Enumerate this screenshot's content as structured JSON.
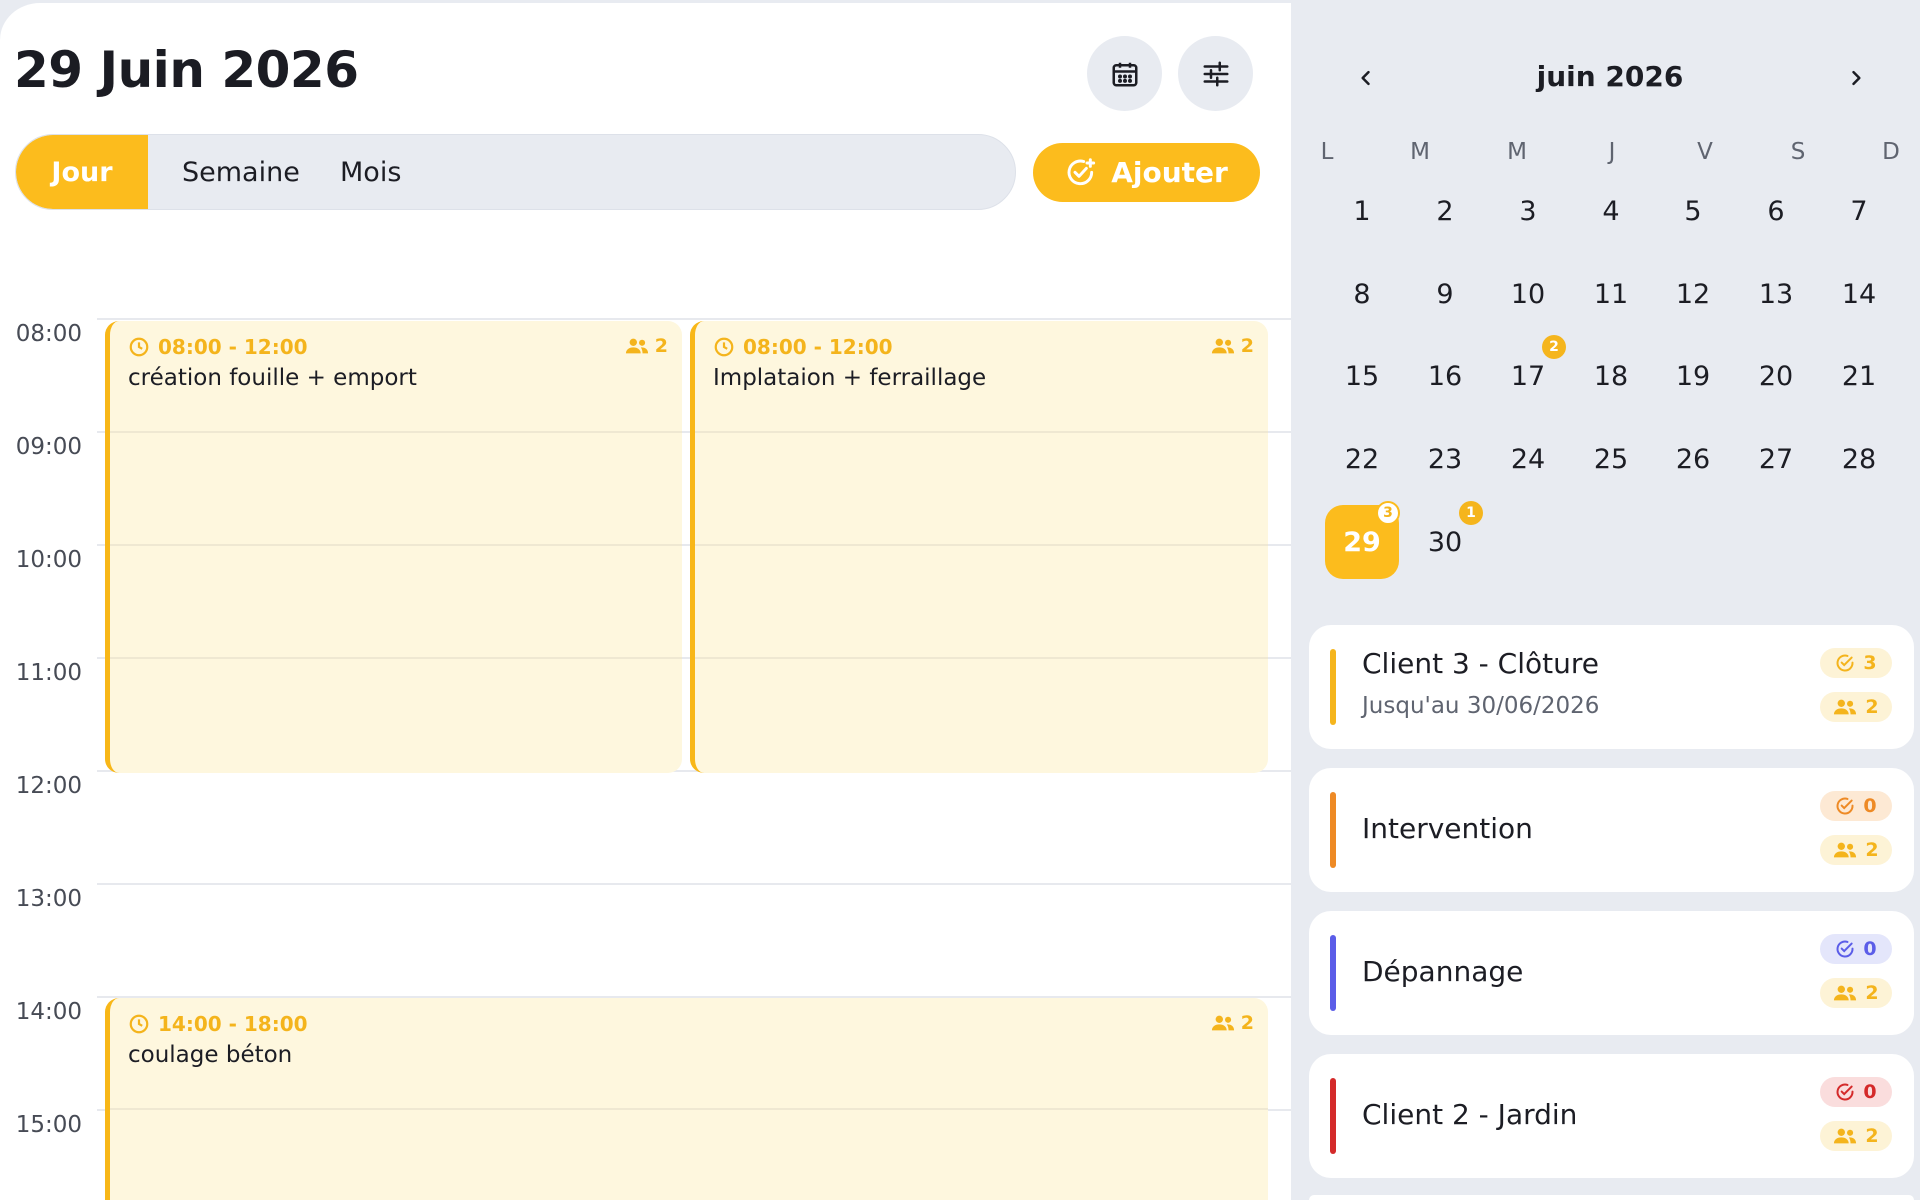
{
  "header": {
    "date_title": "29 Juin 2026",
    "calendar_button_icon": "calendar-icon",
    "filter_button_icon": "sliders-icon"
  },
  "view_tabs": {
    "items": [
      {
        "label": "Jour",
        "active": true
      },
      {
        "label": "Semaine",
        "active": false
      },
      {
        "label": "Mois",
        "active": false
      }
    ]
  },
  "add_button": {
    "label": "Ajouter",
    "icon": "check-plus-icon"
  },
  "timeline": {
    "hours": [
      "08:00",
      "09:00",
      "10:00",
      "11:00",
      "12:00",
      "13:00",
      "14:00",
      "15:00"
    ],
    "events": [
      {
        "time": "08:00 - 12:00",
        "title": "création fouille + emport",
        "people": "2"
      },
      {
        "time": "08:00 - 12:00",
        "title": "Implataion + ferraillage",
        "people": "2"
      },
      {
        "time": "14:00 - 18:00",
        "title": "coulage béton",
        "people": "2"
      }
    ]
  },
  "mini_calendar": {
    "month_label": "juin 2026",
    "weekdays": [
      "L",
      "M",
      "M",
      "J",
      "V",
      "S",
      "D"
    ],
    "days": [
      "1",
      "2",
      "3",
      "4",
      "5",
      "6",
      "7",
      "8",
      "9",
      "10",
      "11",
      "12",
      "13",
      "14",
      "15",
      "16",
      "17",
      "18",
      "19",
      "20",
      "21",
      "22",
      "23",
      "24",
      "25",
      "26",
      "27",
      "28",
      "29",
      "30"
    ],
    "selected_day": "29",
    "badges": {
      "17": "2",
      "29": "3",
      "30": "1"
    },
    "accent_color": "#fcbc1d"
  },
  "projects": [
    {
      "name": "Client 3 - Clôture",
      "subtitle": "Jusqu'au 30/06/2026",
      "done": "3",
      "people": "2",
      "color": "#f5b51d"
    },
    {
      "name": "Intervention",
      "subtitle": "",
      "done": "0",
      "people": "2",
      "color": "#ee8a25"
    },
    {
      "name": "Dépannage",
      "subtitle": "",
      "done": "0",
      "people": "2",
      "color": "#5b5de8"
    },
    {
      "name": "Client 2 - Jardin",
      "subtitle": "",
      "done": "0",
      "people": "2",
      "color": "#d42a2a"
    }
  ]
}
